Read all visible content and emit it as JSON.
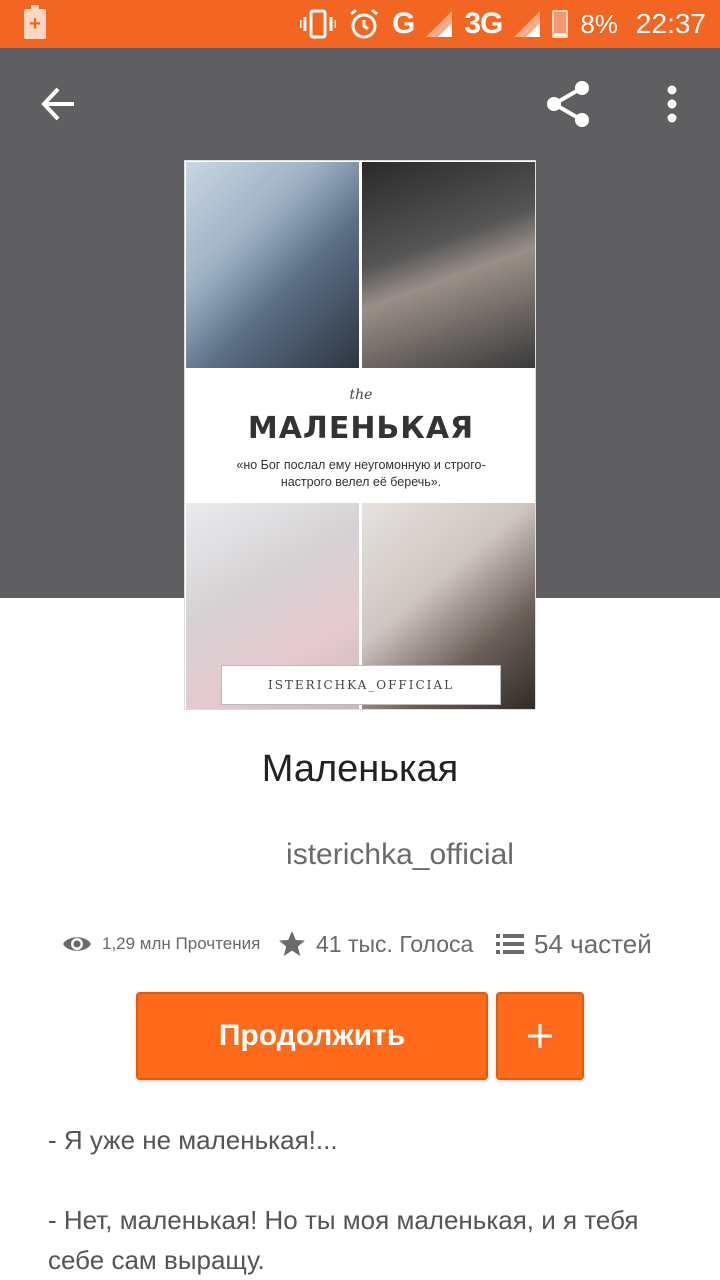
{
  "status_bar": {
    "network": "G",
    "network2": "3G",
    "battery": "8%",
    "time": "22:37",
    "icons": [
      "battery-charging-icon",
      "vibrate-icon",
      "alarm-icon",
      "signal-icon",
      "battery-icon"
    ]
  },
  "header": {
    "icons": [
      "back-arrow-icon",
      "share-icon",
      "more-vertical-icon"
    ]
  },
  "cover": {
    "the": "the",
    "title": "МАЛЕНЬКАЯ",
    "quote": "«но Бог послал ему неугомонную и строго-настрого велел её беречь».",
    "author": "ISTERICHKA_OFFICIAL"
  },
  "story": {
    "title": "Маленькая",
    "author": "isterichka_official"
  },
  "stats": {
    "reads": "1,29 млн Прочтения",
    "votes": "41 тыс. Голоса",
    "parts": "54 частей"
  },
  "actions": {
    "continue_label": "Продолжить",
    "add_label": "+"
  },
  "description": [
    "- Я уже не маленькая!...",
    "- Нет, маленькая! Но ты моя маленькая, и я тебя себе сам выращу."
  ],
  "colors": {
    "accent": "#ff6b1a",
    "status_bar": "#f26522",
    "header_bg": "#5f5f62"
  }
}
